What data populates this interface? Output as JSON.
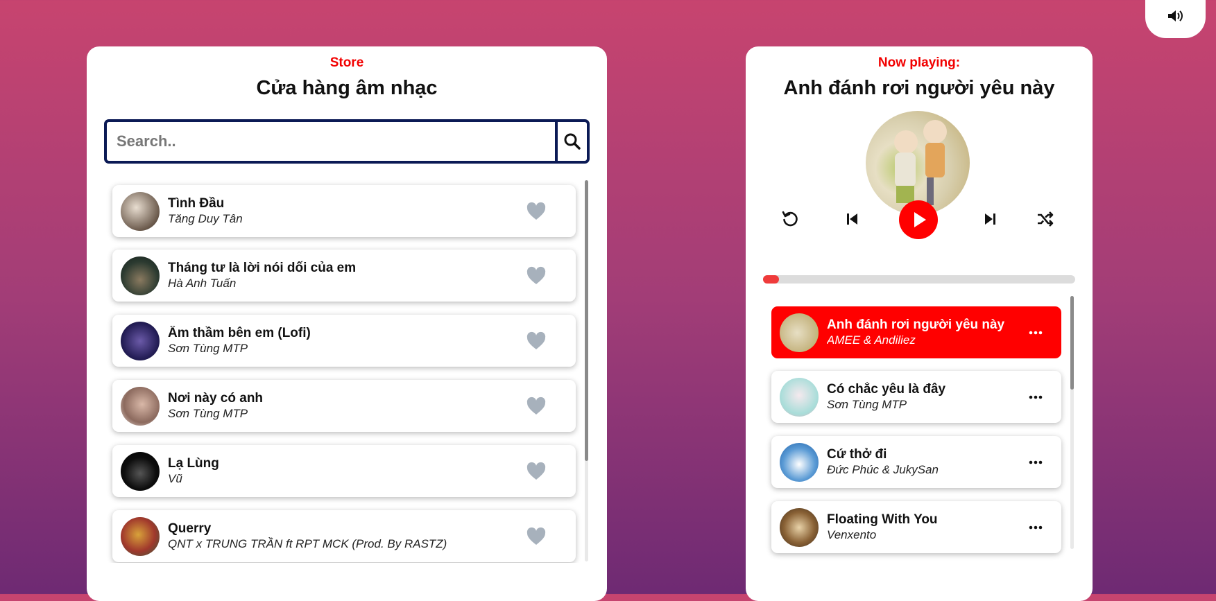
{
  "store": {
    "label": "Store",
    "title": "Cửa hàng âm nhạc",
    "search_placeholder": "Search..",
    "songs": [
      {
        "title": "Tình Đầu",
        "artist": "Tăng Duy Tân"
      },
      {
        "title": "Tháng tư là lời nói dối của em",
        "artist": "Hà Anh Tuấn"
      },
      {
        "title": "Âm thầm bên em (Lofi)",
        "artist": "Sơn Tùng MTP"
      },
      {
        "title": "Nơi này có anh",
        "artist": "Sơn Tùng MTP"
      },
      {
        "title": "Lạ Lùng",
        "artist": "Vũ"
      },
      {
        "title": "Querry",
        "artist": "QNT x TRUNG TRẦN ft RPT MCK (Prod. By RASTZ)"
      }
    ]
  },
  "player": {
    "label": "Now playing:",
    "current_title": "Anh đánh rơi người yêu này",
    "progress": 0.05,
    "playlist": [
      {
        "title": "Anh đánh rơi người yêu này",
        "artist": "AMEE & Andiliez",
        "active": true
      },
      {
        "title": "Có chắc yêu là đây",
        "artist": "Sơn Tùng MTP",
        "active": false
      },
      {
        "title": "Cứ thở đi",
        "artist": "Đức Phúc & JukySan",
        "active": false
      },
      {
        "title": "Floating With You",
        "artist": "Venxento",
        "active": false
      }
    ]
  },
  "colors": {
    "accent": "#ff0000",
    "search_border": "#0b1a55",
    "heart": "#a7b1bc"
  },
  "icons": [
    "search-icon",
    "heart-icon",
    "repeat-icon",
    "previous-icon",
    "play-icon",
    "next-icon",
    "shuffle-icon",
    "more-icon",
    "volume-icon"
  ]
}
